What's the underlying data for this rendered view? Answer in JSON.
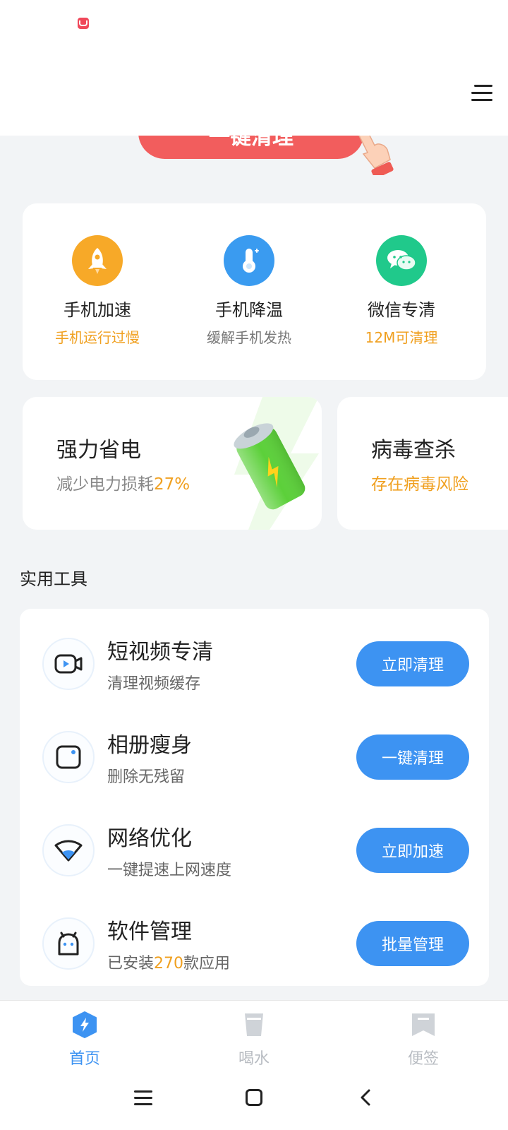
{
  "header": {
    "menu_icon": "menu-icon"
  },
  "clean_button": {
    "label": "一键清理"
  },
  "quick_actions": [
    {
      "icon": "rocket-icon",
      "color": "#f7a928",
      "title": "手机加速",
      "subtitle": "手机运行过慢",
      "subtitle_color": "#f0a020"
    },
    {
      "icon": "thermometer-icon",
      "color": "#3a9bf0",
      "title": "手机降温",
      "subtitle": "缓解手机发热",
      "subtitle_color": "#777777"
    },
    {
      "icon": "wechat-icon",
      "color": "#20c98b",
      "title": "微信专清",
      "subtitle": "12M可清理",
      "subtitle_color": "#f0a020"
    }
  ],
  "features": {
    "power": {
      "title": "强力省电",
      "subtitle_prefix": "减少电力损耗",
      "subtitle_value": "27%"
    },
    "virus": {
      "title": "病毒查杀",
      "subtitle": "存在病毒风险"
    }
  },
  "tools_section": {
    "title": "实用工具"
  },
  "tools": [
    {
      "icon": "video-camera-icon",
      "title": "短视频专清",
      "subtitle": "清理视频缓存",
      "button": "立即清理"
    },
    {
      "icon": "photo-album-icon",
      "title": "相册瘦身",
      "subtitle": "删除无残留",
      "button": "一键清理"
    },
    {
      "icon": "wifi-icon",
      "title": "网络优化",
      "subtitle": "一键提速上网速度",
      "button": "立即加速"
    },
    {
      "icon": "android-icon",
      "title": "软件管理",
      "subtitle_prefix": "已安装",
      "subtitle_value": "270",
      "subtitle_suffix": "款应用",
      "button": "批量管理"
    }
  ],
  "tabs": [
    {
      "icon": "home-bolt-icon",
      "label": "首页",
      "active": true
    },
    {
      "icon": "water-cup-icon",
      "label": "喝水",
      "active": false
    },
    {
      "icon": "bookmark-icon",
      "label": "便签",
      "active": false
    }
  ],
  "colors": {
    "accent": "#3d93f2",
    "warning": "#f0a020",
    "danger": "#f25d5d",
    "background": "#f2f4f6"
  }
}
